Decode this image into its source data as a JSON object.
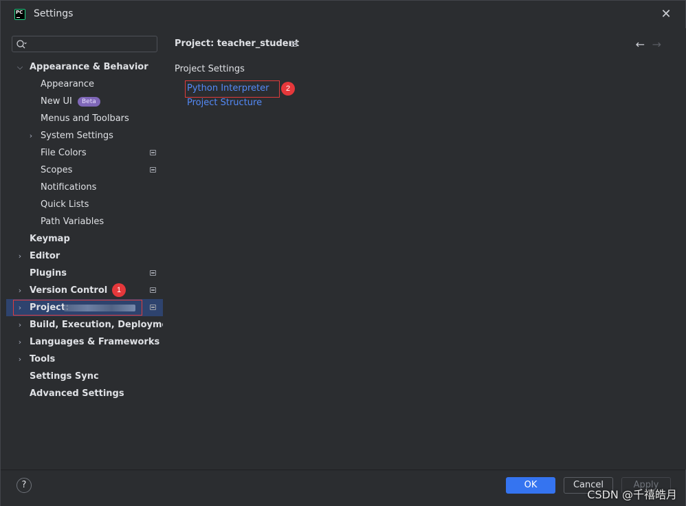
{
  "window": {
    "title": "Settings",
    "logo_text": "PC"
  },
  "search": {
    "placeholder": "",
    "value": ""
  },
  "tree": {
    "appearance_behavior": "Appearance & Behavior",
    "appearance": "Appearance",
    "new_ui": "New UI",
    "new_ui_badge": "Beta",
    "menus_toolbars": "Menus and Toolbars",
    "system_settings": "System Settings",
    "file_colors": "File Colors",
    "scopes": "Scopes",
    "notifications": "Notifications",
    "quick_lists": "Quick Lists",
    "path_variables": "Path Variables",
    "keymap": "Keymap",
    "editor": "Editor",
    "plugins": "Plugins",
    "version_control": "Version Control",
    "project": "Project:",
    "build": "Build, Execution, Deployment",
    "languages": "Languages & Frameworks",
    "tools": "Tools",
    "settings_sync": "Settings Sync",
    "advanced": "Advanced Settings"
  },
  "annotations": {
    "one": "1",
    "two": "2"
  },
  "main": {
    "breadcrumb": "Project: teacher_student",
    "section": "Project Settings",
    "links": [
      "Python Interpreter",
      "Project Structure"
    ]
  },
  "footer": {
    "help": "?",
    "ok": "OK",
    "cancel": "Cancel",
    "apply": "Apply",
    "watermark": "CSDN @千禧皓月"
  },
  "colors": {
    "accent": "#3574f0",
    "link": "#548af7",
    "selection": "#2e436e",
    "annotation_red": "#e5383b"
  }
}
